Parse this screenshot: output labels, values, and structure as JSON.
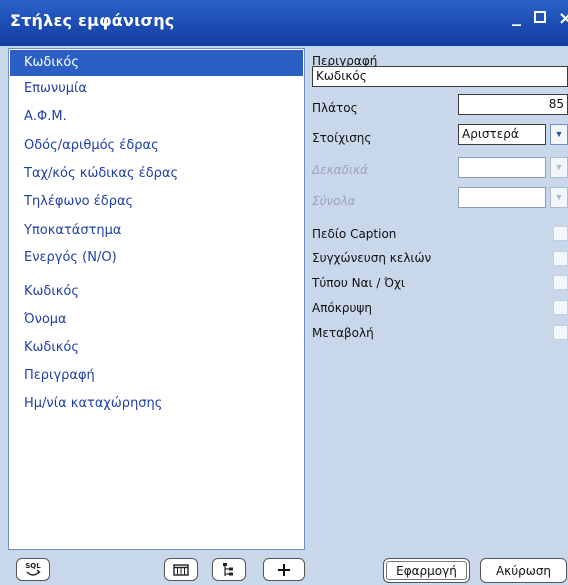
{
  "window": {
    "title": "Στήλες εμφάνισης"
  },
  "columns_list": [
    {
      "label": "Κωδικός",
      "selected": true
    },
    {
      "label": "Επωνυμία",
      "selected": false
    },
    {
      "label": "Α.Φ.Μ.",
      "selected": false
    },
    {
      "label": "Οδός/αριθμός έδρας",
      "selected": false
    },
    {
      "label": "Ταχ/κός κώδικας έδρας",
      "selected": false
    },
    {
      "label": "Τηλέφωνο έδρας",
      "selected": false
    },
    {
      "label": "Υποκατάστημα",
      "selected": false
    },
    {
      "label": "Ενεργός (Ν/Ο)",
      "selected": false
    },
    {
      "label": "Κωδικός",
      "selected": false
    },
    {
      "label": "Όνομα",
      "selected": false
    },
    {
      "label": "Κωδικός",
      "selected": false
    },
    {
      "label": "Περιγραφή",
      "selected": false
    },
    {
      "label": "Ημ/νία καταχώρησης",
      "selected": false
    }
  ],
  "properties": {
    "description_label": "Περιγραφή",
    "description_value": "Κωδικός",
    "width_label": "Πλάτος",
    "width_value": "85",
    "alignment_label": "Στοίχισης",
    "alignment_value": "Αριστερά",
    "decimals_label": "Δεκαδικά",
    "decimals_value": "",
    "totals_label": "Σύνολα",
    "totals_value": "",
    "checkboxes": [
      {
        "label": "Πεδίο Caption",
        "checked": false
      },
      {
        "label": "Συγχώνευση κελιών",
        "checked": false
      },
      {
        "label": "Τύπου Ναι / Όχι",
        "checked": false
      },
      {
        "label": "Απόκρυψη",
        "checked": false
      },
      {
        "label": "Μεταβολή",
        "checked": false
      }
    ]
  },
  "buttons": {
    "sql_label": "SQL",
    "apply_label": "Εφαρμογή",
    "cancel_label": "Ακύρωση"
  }
}
